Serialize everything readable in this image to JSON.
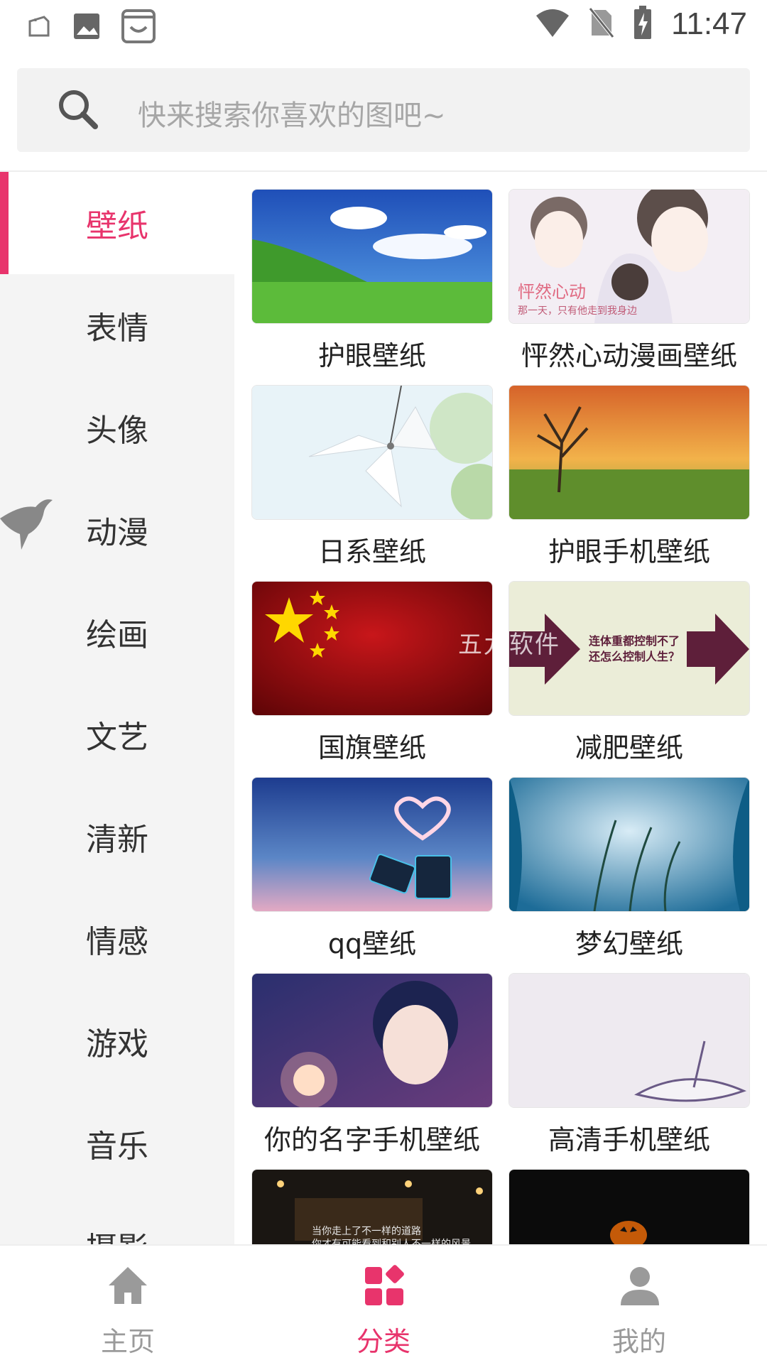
{
  "status_bar": {
    "time": "11:47"
  },
  "search": {
    "placeholder": "快来搜索你喜欢的图吧~"
  },
  "sidebar": {
    "items": [
      {
        "label": "壁纸",
        "active": true
      },
      {
        "label": "表情"
      },
      {
        "label": "头像"
      },
      {
        "label": "动漫"
      },
      {
        "label": "绘画"
      },
      {
        "label": "文艺"
      },
      {
        "label": "清新"
      },
      {
        "label": "情感"
      },
      {
        "label": "游戏"
      },
      {
        "label": "音乐"
      },
      {
        "label": "摄影"
      }
    ]
  },
  "grid": {
    "items": [
      {
        "label": "护眼壁纸"
      },
      {
        "label": "怦然心动漫画壁纸",
        "thumb_text": "怦然心动",
        "thumb_subtext": "那一天，只有他走到我身边"
      },
      {
        "label": "日系壁纸"
      },
      {
        "label": "护眼手机壁纸"
      },
      {
        "label": "国旗壁纸"
      },
      {
        "label": "减肥壁纸",
        "thumb_text": "连体重都控制不了",
        "thumb_subtext": "还怎么控制人生？"
      },
      {
        "label": "qq壁纸"
      },
      {
        "label": "梦幻壁纸"
      },
      {
        "label": "你的名字手机壁纸"
      },
      {
        "label": "高清手机壁纸"
      },
      {
        "label": "",
        "thumb_text": "当你走上了不一样的道路",
        "thumb_subtext": "你才有可能看到和别人不一样的风景"
      },
      {
        "label": ""
      }
    ],
    "watermark": "五九软件"
  },
  "bottom_nav": {
    "items": [
      {
        "label": "主页",
        "icon": "home-icon"
      },
      {
        "label": "分类",
        "icon": "category-icon",
        "active": true
      },
      {
        "label": "我的",
        "icon": "user-icon"
      }
    ]
  },
  "colors": {
    "accent": "#e8346c",
    "inactive": "#9a9a9a"
  }
}
